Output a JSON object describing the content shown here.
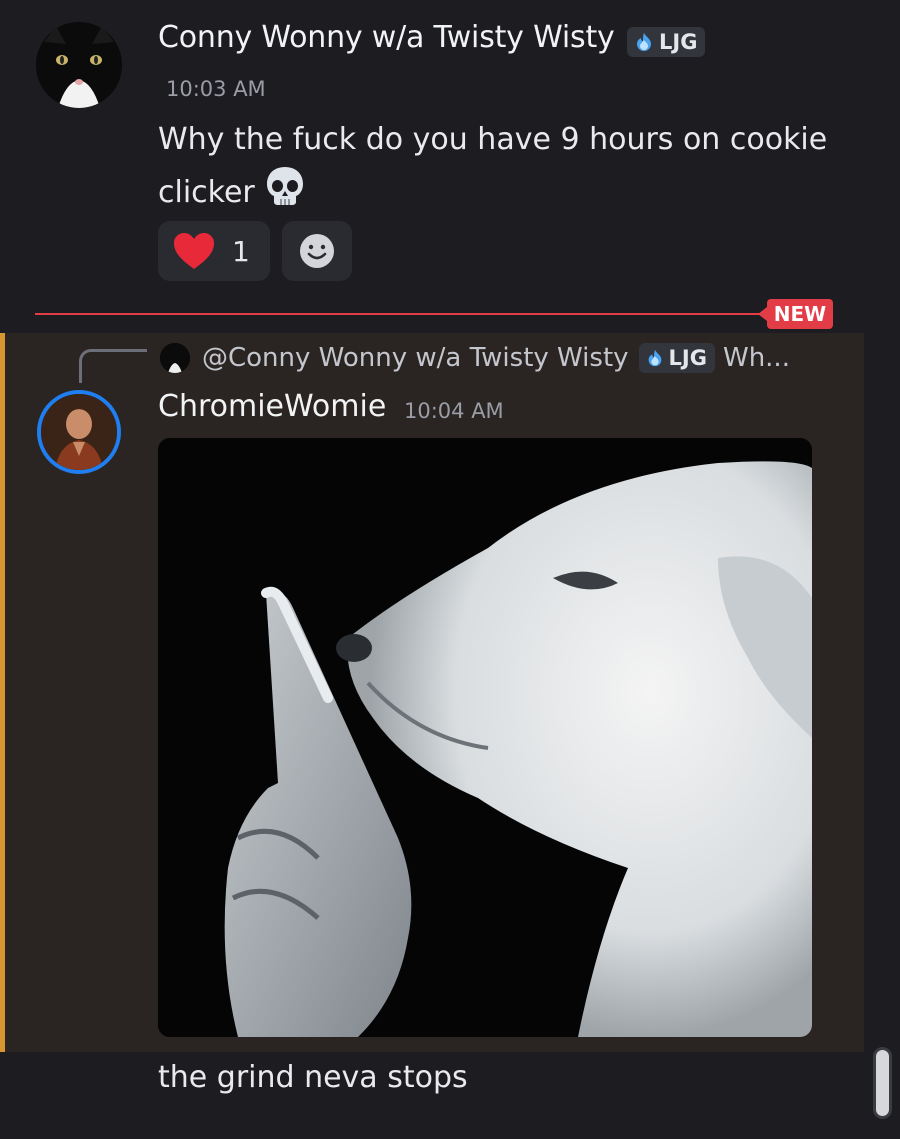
{
  "message1": {
    "author": "Conny Wonny w/a Twisty Wisty",
    "tag": "LJG",
    "timestamp": "10:03 AM",
    "text": "Why the fuck do you have 9 hours on cookie clicker",
    "emoji": "skull-icon",
    "reactions": [
      {
        "emoji": "heart-icon",
        "count": "1"
      },
      {
        "emoji": "add-reaction-icon"
      }
    ]
  },
  "divider": {
    "label": "NEW",
    "color": "#e23d47"
  },
  "message2": {
    "reply": {
      "mention": "@Conny Wonny w/a Twisty Wisty",
      "tag": "LJG",
      "snippet": "Wh..."
    },
    "author": "ChromieWomie",
    "timestamp": "10:04 AM",
    "attachment": "image-attachment",
    "highlight_color": "#d7962f"
  },
  "message3": {
    "text": "the grind neva stops"
  },
  "colors": {
    "background": "#1c1c21",
    "mention_background": "#2a2522",
    "avatar_ring": "#1f7ef0",
    "tag_icon": "#4aa3f0"
  }
}
